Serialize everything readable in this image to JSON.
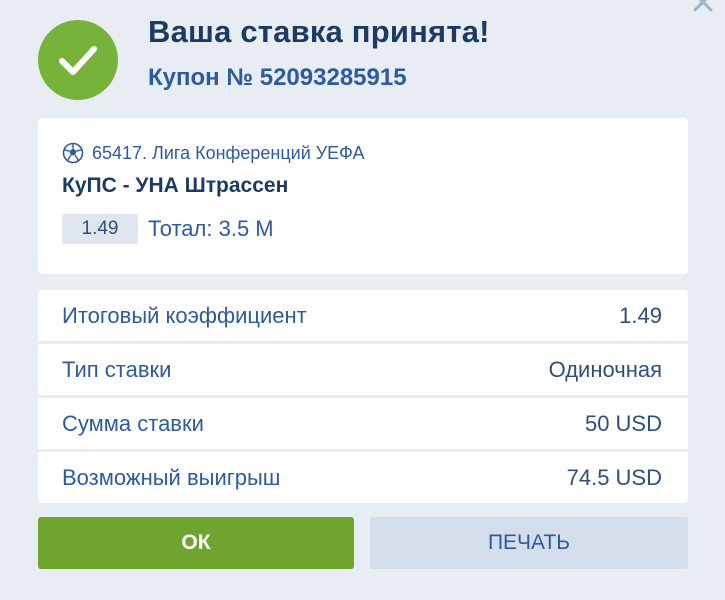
{
  "header": {
    "title": "Ваша ставка принята!",
    "coupon": "Купон № 52093285915"
  },
  "event": {
    "league": "65417. Лига Конференций УЕФА",
    "match": "КуПС - УНА Штрассен",
    "odds": "1.49",
    "bet_outcome": "Тотал: 3.5 М"
  },
  "summary": [
    {
      "label": "Итоговый коэффициент",
      "value": "1.49"
    },
    {
      "label": "Тип ставки",
      "value": "Одиночная"
    },
    {
      "label": "Сумма ставки",
      "value": "50 USD"
    },
    {
      "label": "Возможный выигрыш",
      "value": "74.5 USD"
    }
  ],
  "buttons": {
    "ok": "ОК",
    "print": "ПЕЧАТЬ"
  },
  "icons": {
    "close": "close-icon",
    "success": "checkmark-icon",
    "sport": "soccer-ball-icon"
  },
  "colors": {
    "success_green": "#77b33a",
    "ok_button": "#6fa52f",
    "title_navy": "#1d3b62",
    "text_blue": "#2e5aa0",
    "background": "#e7edf3"
  }
}
